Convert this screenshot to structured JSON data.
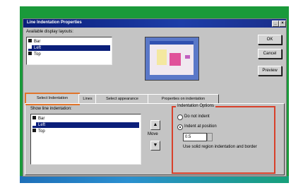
{
  "window": {
    "title": "Line Indentation Properties",
    "min_glyph": "_",
    "close_glyph": "×"
  },
  "top_list": {
    "label": "Available display layouts:",
    "items": [
      {
        "label": "Bar",
        "selected": false
      },
      {
        "label": "Left",
        "selected": true
      },
      {
        "label": "Top",
        "selected": false
      }
    ]
  },
  "buttons": {
    "ok": "OK",
    "cancel": "Cancel",
    "preview": "Preview"
  },
  "tabs": [
    {
      "label": "Select Indentation",
      "active": true
    },
    {
      "label": "Lines",
      "active": false
    },
    {
      "label": "Select appearance",
      "active": false
    },
    {
      "label": "Properties on indentation",
      "active": false
    }
  ],
  "bottom_list": {
    "label": "Show line indentation:",
    "items": [
      {
        "label": "Bar",
        "selected": false
      },
      {
        "label": "Left",
        "selected": true
      },
      {
        "label": "Top",
        "selected": false
      }
    ]
  },
  "move": {
    "up_glyph": "▲",
    "label": "Move",
    "down_glyph": "▼"
  },
  "group": {
    "title": "Indentation Options",
    "option1": "Do not indent",
    "option2": "Indent at position",
    "spin_value": "0.5",
    "note": "Use solid region indentation and border"
  }
}
